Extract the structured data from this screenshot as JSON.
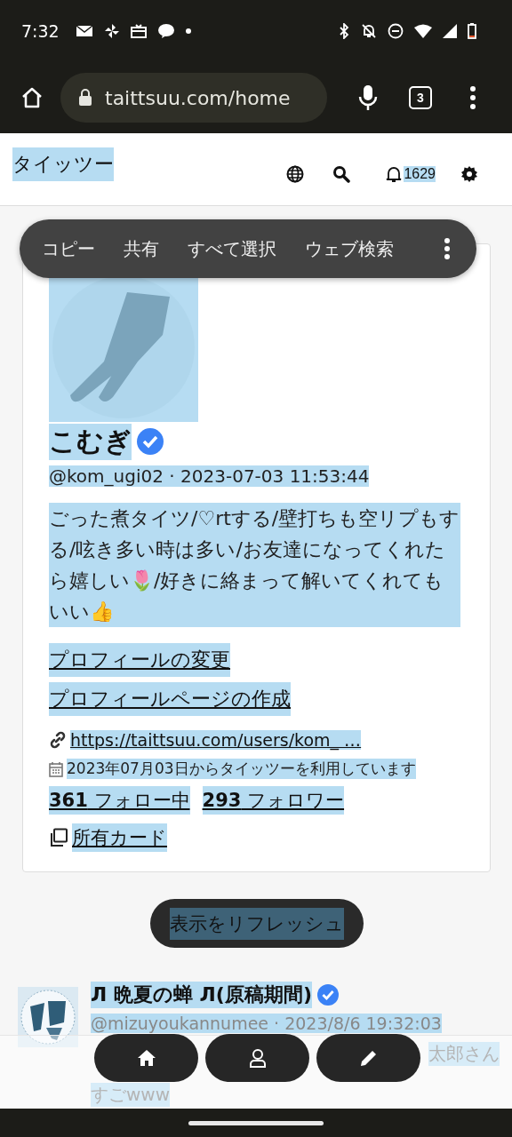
{
  "status_bar": {
    "time": "7:32"
  },
  "browser": {
    "url": "taittsuu.com/home",
    "tab_count": "3"
  },
  "header": {
    "logo": "タイッツー",
    "notification_count": "1629"
  },
  "selection_menu": {
    "items": [
      "コピー",
      "共有",
      "すべて選択",
      "ウェブ検索"
    ]
  },
  "text_selected": true,
  "profile": {
    "name": "こむぎ",
    "verified": true,
    "handle_time": "@kom_ugi02 · 2023-07-03 11:53:44",
    "bio": "ごった煮タイツ/♡rtする/壁打ちも空リプもする/呟き多い時は多い/お友達になってくれたら嬉しい🌷/好きに絡まって解いてくれてもいい👍",
    "links": [
      "プロフィールの変更",
      "プロフィールページの作成"
    ],
    "url": "https://taittsuu.com/users/kom_ …",
    "joined": "2023年07月03日からタイッツーを利用しています",
    "following_count": "361",
    "following_label": "フォロー中",
    "followers_count": "293",
    "followers_label": "フォロワー",
    "cards": "所有カード"
  },
  "refresh_button": "表示をリフレッシュ",
  "post": {
    "name": "Л 晩夏の蝉 Л(原稿期間)",
    "verified": true,
    "handle_time": "@mizuyoukannumee · 2023/8/6 19:32:03",
    "body_lines": [
      "太郎さん",
      "すごwww"
    ]
  }
}
